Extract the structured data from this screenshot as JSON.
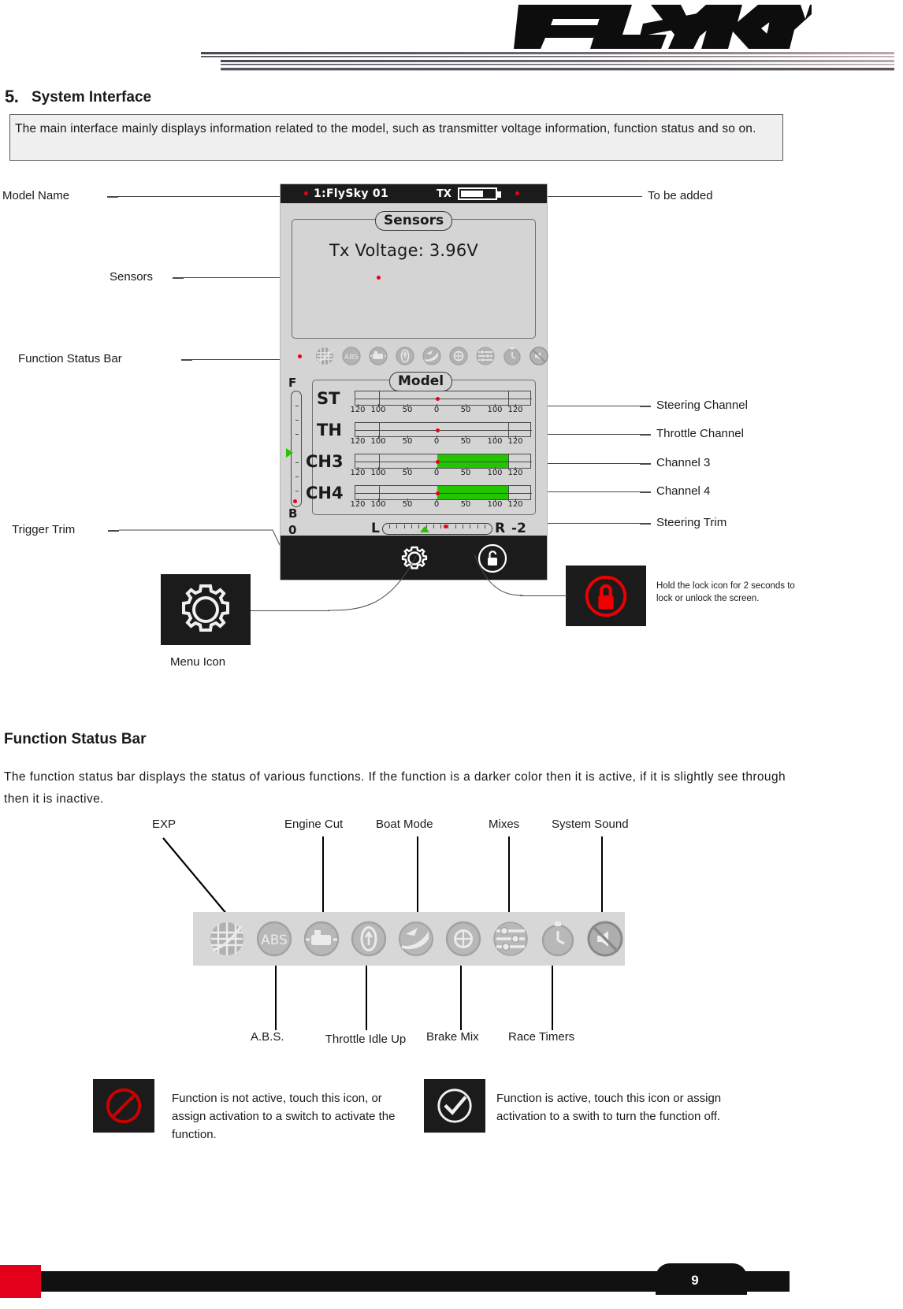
{
  "header": {
    "logo_text": "FLYSKY"
  },
  "section": {
    "number": "5.",
    "title": "System Interface",
    "intro": "The main interface mainly displays information related to the model, such as transmitter voltage information, function status and so on."
  },
  "callouts": {
    "model_name": "Model Name",
    "sensors": "Sensors",
    "function_status_bar": "Function Status Bar",
    "trigger_trim": "Trigger Trim",
    "to_be_added": "To be added",
    "steering_channel": "Steering Channel",
    "throttle_channel": "Throttle Channel",
    "channel_3": "Channel 3",
    "channel_4": "Channel 4",
    "steering_trim": "Steering Trim",
    "menu_icon": "Menu Icon",
    "lock_note": "Hold the lock icon for 2 seconds to lock or unlock the screen."
  },
  "lcd": {
    "model_name": "1:FlySky 01",
    "tx_label": "TX",
    "battery_percent": 60,
    "sensors_panel_title": "Sensors",
    "tx_voltage": "Tx Voltage: 3.96V",
    "model_panel_title": "Model",
    "channels": [
      {
        "label": "ST",
        "value": 0,
        "fill": 0
      },
      {
        "label": "TH",
        "value": 0,
        "fill": 0
      },
      {
        "label": "CH3",
        "value": 100,
        "fill": 100
      },
      {
        "label": "CH4",
        "value": 100,
        "fill": 100
      }
    ],
    "tick_labels": [
      "120",
      "100",
      "50",
      "0",
      "50",
      "100",
      "120"
    ],
    "trigger_trim": {
      "top_label": "F",
      "bottom_label": "B",
      "value": "0"
    },
    "steering_trim": {
      "left_label": "L",
      "right_label": "R",
      "value": "-2"
    },
    "bar_icons": [
      "exp-icon",
      "abs-icon",
      "engine-cut-icon",
      "throttle-idle-up-icon",
      "boat-mode-icon",
      "brake-mix-icon",
      "mixes-icon",
      "race-timers-icon",
      "system-sound-icon"
    ],
    "gear_icon": "gear-icon",
    "lock_icon": "unlock-icon"
  },
  "status_bar_section": {
    "title": "Function Status Bar",
    "description": "The function status bar displays the status of various functions. If the function is a darker color then it is active, if it is slightly see through then it is inactive.",
    "top_labels": [
      "EXP",
      "Engine Cut",
      "Boat Mode",
      "Mixes",
      "System Sound"
    ],
    "bottom_labels": [
      "A.B.S.",
      "Throttle Idle Up",
      "Brake Mix",
      "Race Timers"
    ],
    "icons": [
      "exp-icon",
      "abs-icon",
      "engine-cut-icon",
      "throttle-idle-up-icon",
      "boat-mode-icon",
      "brake-mix-icon",
      "mixes-icon",
      "race-timers-icon",
      "system-sound-icon"
    ]
  },
  "legend": {
    "inactive_icon": "no-entry-icon",
    "inactive_text": "Function is not active, touch this icon, or assign activation to a switch to activate the function.",
    "active_icon": "check-circle-icon",
    "active_text": "Function is active, touch this icon or assign activation to a swith to turn the function off."
  },
  "footer": {
    "page_number": "9"
  },
  "colors": {
    "accent_red": "#e2001a",
    "channel_green": "#25c400",
    "lcd_bg": "#d4d4d4",
    "dark": "#1b1b1b"
  }
}
